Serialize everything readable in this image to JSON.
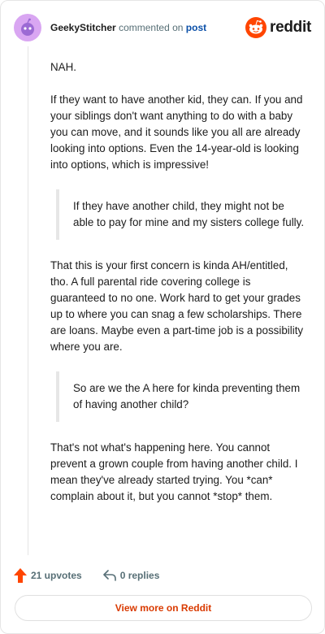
{
  "header": {
    "author": "GeekyStitcher",
    "verb": "commented on",
    "post_link": "post",
    "brand": "reddit"
  },
  "comment": {
    "paragraphs": [
      "NAH.",
      "If they want to have another kid, they can. If you and your siblings don't want anything to do with a baby you can move, and it sounds like you all are already looking into options. Even the 14-year-old is looking into options, which is impressive!",
      "That this is your first concern is kinda AH/entitled, tho. A full parental ride covering college is guaranteed to no one. Work hard to get your grades up to where you can snag a few scholarships. There are loans. Maybe even a part-time job is a possibility where you are.",
      "That's not what's happening here. You cannot prevent a grown couple from having another child. I mean they've already started trying. You *can* complain about it, but you cannot *stop* them."
    ],
    "quotes": [
      "If they have another child, they might not be able to pay for mine and my sisters college fully.",
      "So are we the A here for kinda preventing them of having another child?"
    ]
  },
  "actions": {
    "upvotes": "21 upvotes",
    "replies": "0 replies"
  },
  "cta": "View more on Reddit",
  "colors": {
    "accent": "#d93a00",
    "upvote": "#ff4500",
    "avatar": "#d9a6f2",
    "link": "#0a4fa8",
    "muted": "#576f76"
  },
  "icons": [
    "snoo-avatar-icon",
    "reddit-logo-icon",
    "upvote-arrow-icon",
    "reply-icon"
  ]
}
